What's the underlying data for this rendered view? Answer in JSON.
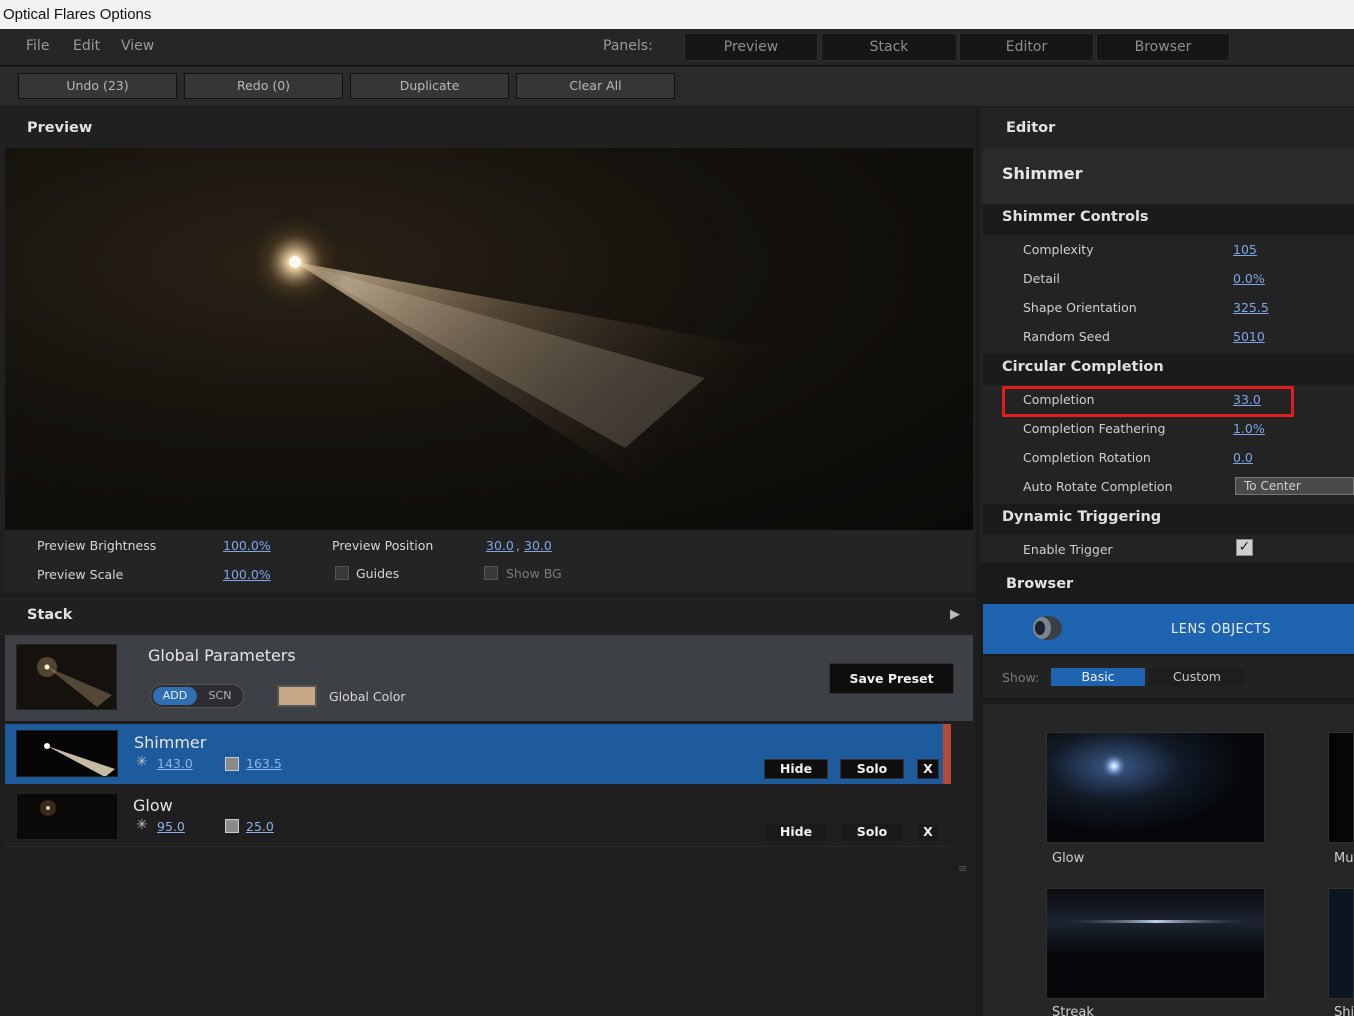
{
  "window": {
    "title": "Optical Flares Options"
  },
  "menu": {
    "items": [
      "File",
      "Edit",
      "View"
    ],
    "panels_label": "Panels:",
    "panel_buttons": [
      "Preview",
      "Stack",
      "Editor",
      "Browser"
    ]
  },
  "toolbar": {
    "undo": "Undo (23)",
    "redo": "Redo (0)",
    "duplicate": "Duplicate",
    "clear_all": "Clear All"
  },
  "preview": {
    "title": "Preview",
    "brightness_label": "Preview Brightness",
    "brightness_value": "100.0%",
    "scale_label": "Preview Scale",
    "scale_value": "100.0%",
    "position_label": "Preview Position",
    "position_x": "30.0",
    "position_sep": ",",
    "position_y": "30.0",
    "guides_label": "Guides",
    "show_bg_label": "Show BG"
  },
  "stack": {
    "title": "Stack",
    "global": {
      "title": "Global Parameters",
      "blend_add": "ADD",
      "blend_scn": "SCN",
      "color_label": "Global Color",
      "color": "#c8a886",
      "save_preset": "Save Preset"
    },
    "layers": [
      {
        "name": "Shimmer",
        "brightness": "143.0",
        "scale": "163.5",
        "hide": "Hide",
        "solo": "Solo",
        "remove": "X",
        "selected": true
      },
      {
        "name": "Glow",
        "brightness": "95.0",
        "scale": "25.0",
        "hide": "Hide",
        "solo": "Solo",
        "remove": "X",
        "selected": false
      }
    ]
  },
  "editor": {
    "title": "Editor",
    "object_name": "Shimmer",
    "sections": {
      "shimmer_controls": {
        "title": "Shimmer Controls",
        "rows": [
          {
            "label": "Complexity",
            "value": "105"
          },
          {
            "label": "Detail",
            "value": "0.0%"
          },
          {
            "label": "Shape Orientation",
            "value": "325.5"
          },
          {
            "label": "Random Seed",
            "value": "5010"
          }
        ]
      },
      "circular_completion": {
        "title": "Circular Completion",
        "rows": [
          {
            "label": "Completion",
            "value": "33.0"
          },
          {
            "label": "Completion Feathering",
            "value": "1.0%"
          },
          {
            "label": "Completion Rotation",
            "value": "0.0"
          },
          {
            "label": "Auto Rotate Completion",
            "value": "To Center"
          }
        ]
      },
      "dynamic_triggering": {
        "title": "Dynamic Triggering",
        "rows": [
          {
            "label": "Enable Trigger",
            "value": "✓",
            "checked": true
          }
        ]
      }
    }
  },
  "browser": {
    "title": "Browser",
    "tab": "LENS OBJECTS",
    "show_label": "Show:",
    "show_options": [
      "Basic",
      "Custom"
    ],
    "items": [
      "Glow",
      "Mu",
      "Streak",
      "Shi"
    ]
  },
  "colors": {
    "accent_blue": "#1d63b0",
    "link_blue": "#7fa6e6",
    "highlight_red": "#e01e1e"
  }
}
